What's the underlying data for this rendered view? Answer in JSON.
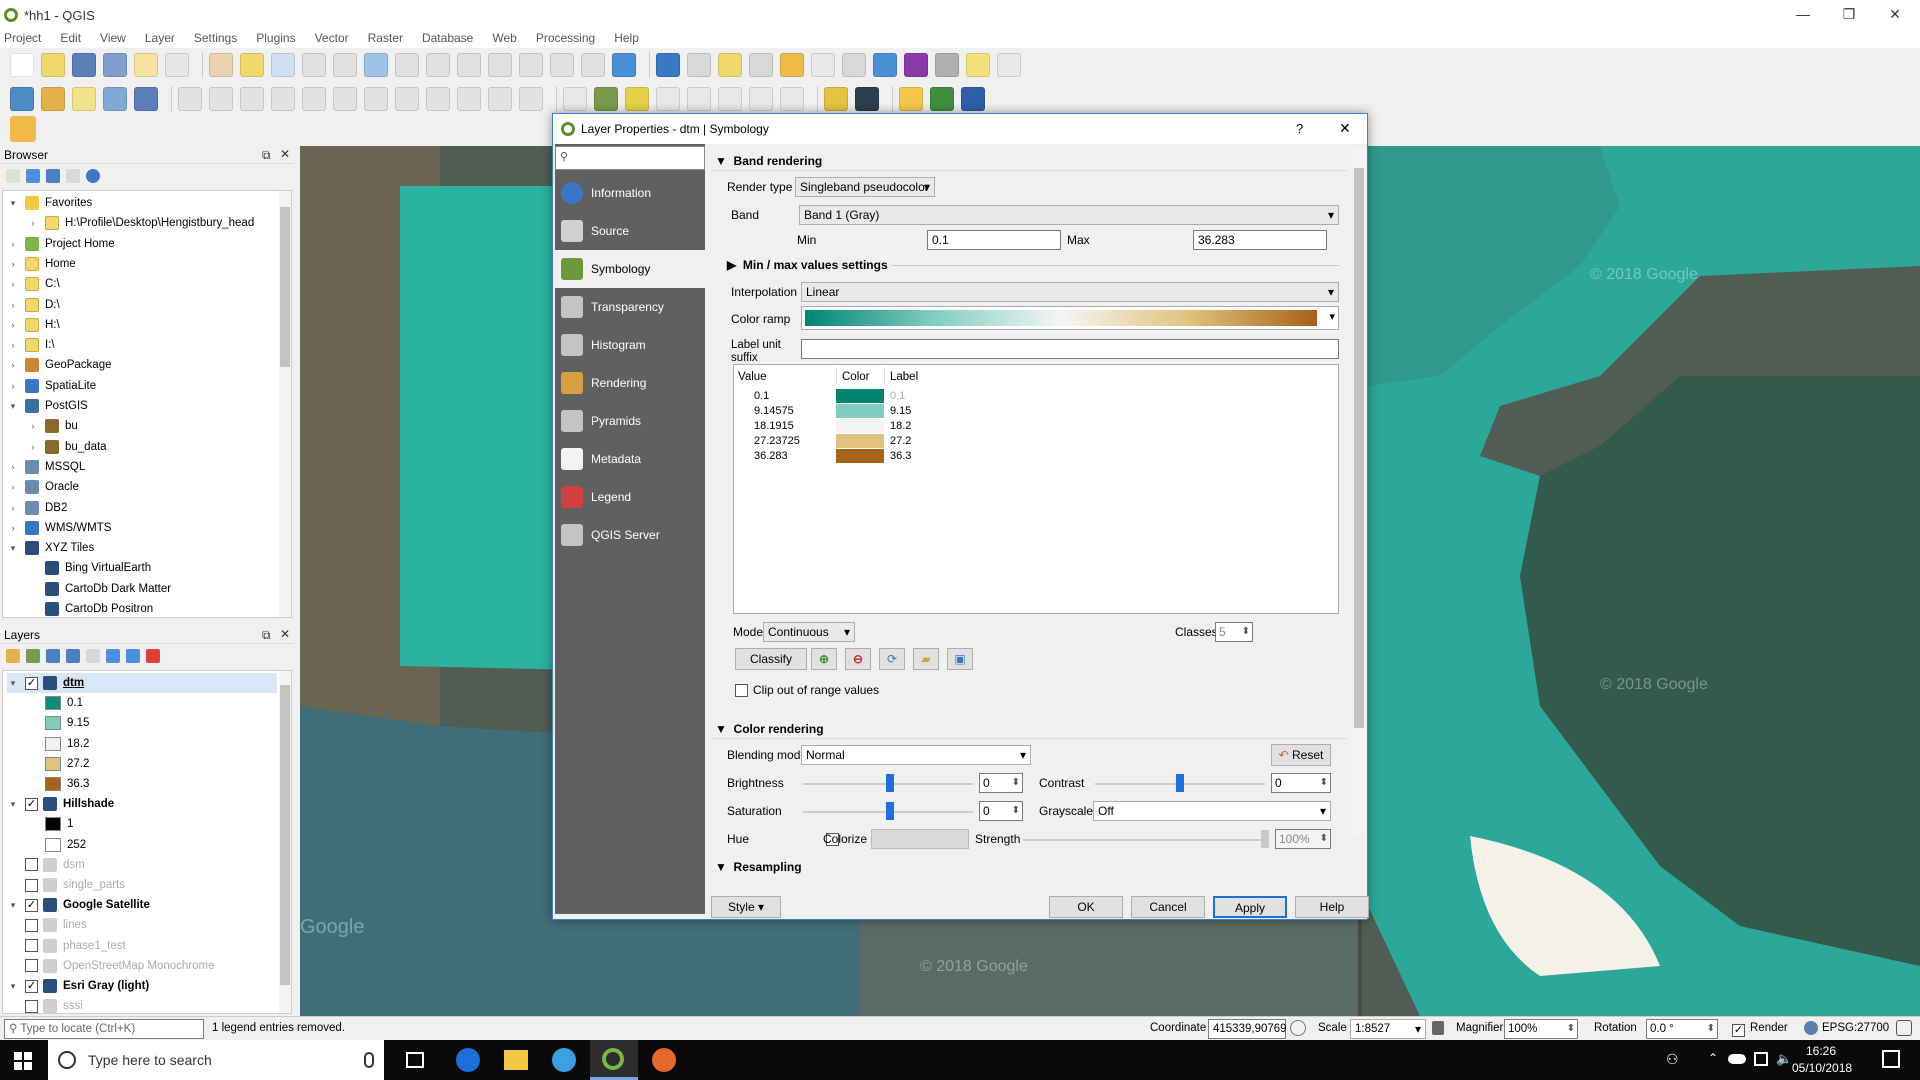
{
  "window": {
    "title": "*hh1 - QGIS",
    "controls": [
      "—",
      "❐",
      "✕"
    ]
  },
  "menu": [
    "Project",
    "Edit",
    "View",
    "Layer",
    "Settings",
    "Plugins",
    "Vector",
    "Raster",
    "Database",
    "Web",
    "Processing",
    "Help"
  ],
  "browser": {
    "title": "Browser",
    "items": [
      {
        "label": "Favorites",
        "type": "star",
        "level": 0,
        "expanded": true
      },
      {
        "label": "H:\\Profile\\Desktop\\Hengistbury_head",
        "type": "folder",
        "level": 1
      },
      {
        "label": "Project Home",
        "type": "home-green",
        "level": 0
      },
      {
        "label": "Home",
        "type": "folder",
        "level": 0
      },
      {
        "label": "C:\\",
        "type": "folder",
        "level": 0
      },
      {
        "label": "D:\\",
        "type": "folder",
        "level": 0
      },
      {
        "label": "H:\\",
        "type": "folder",
        "level": 0
      },
      {
        "label": "I:\\",
        "type": "folder",
        "level": 0
      },
      {
        "label": "GeoPackage",
        "type": "geopackage",
        "level": 0
      },
      {
        "label": "SpatiaLite",
        "type": "feather",
        "level": 0
      },
      {
        "label": "PostGIS",
        "type": "elephant",
        "level": 0,
        "expanded": true
      },
      {
        "label": "bu",
        "type": "schema",
        "level": 1
      },
      {
        "label": "bu_data",
        "type": "schema",
        "level": 1
      },
      {
        "label": "MSSQL",
        "type": "db",
        "level": 0
      },
      {
        "label": "Oracle",
        "type": "db",
        "level": 0
      },
      {
        "label": "DB2",
        "type": "db",
        "level": 0
      },
      {
        "label": "WMS/WMTS",
        "type": "globe",
        "level": 0
      },
      {
        "label": "XYZ Tiles",
        "type": "tiles",
        "level": 0,
        "expanded": true
      },
      {
        "label": "Bing VirtualEarth",
        "type": "tiles",
        "level": 1
      },
      {
        "label": "CartoDb Dark Matter",
        "type": "tiles",
        "level": 1
      },
      {
        "label": "CartoDb Positron",
        "type": "tiles",
        "level": 1
      }
    ]
  },
  "layers": {
    "title": "Layers",
    "items": [
      {
        "label": "dtm",
        "kind": "layer",
        "checked": true,
        "bold": true,
        "underline": true,
        "expanded": true
      },
      {
        "label": "0.1",
        "kind": "legend",
        "color": "#118a7a"
      },
      {
        "label": "9.15",
        "kind": "legend",
        "color": "#7fcdbb"
      },
      {
        "label": "18.2",
        "kind": "legend",
        "color": "#f2f2f0"
      },
      {
        "label": "27.2",
        "kind": "legend",
        "color": "#dfc27d"
      },
      {
        "label": "36.3",
        "kind": "legend",
        "color": "#a6611a"
      },
      {
        "label": "Hillshade",
        "kind": "layer",
        "checked": true,
        "bold": true,
        "expanded": true
      },
      {
        "label": "1",
        "kind": "legend",
        "color": "#000000"
      },
      {
        "label": "252",
        "kind": "legend",
        "color": "#ffffff"
      },
      {
        "label": "dsm",
        "kind": "layer",
        "checked": false,
        "grey": true
      },
      {
        "label": "single_parts",
        "kind": "layer",
        "checked": false,
        "grey": true
      },
      {
        "label": "Google Satellite",
        "kind": "layer",
        "checked": true,
        "bold": true,
        "expanded": true
      },
      {
        "label": "lines",
        "kind": "layer",
        "checked": false,
        "grey": true
      },
      {
        "label": "phase1_test",
        "kind": "layer",
        "checked": false,
        "grey": true
      },
      {
        "label": "OpenStreetMap Monochrome",
        "kind": "layer",
        "checked": false,
        "grey": true
      },
      {
        "label": "Esri Gray (light)",
        "kind": "layer",
        "checked": true,
        "bold": true,
        "expanded": true
      },
      {
        "label": "sssi",
        "kind": "layer",
        "checked": false,
        "grey": true
      }
    ]
  },
  "map": {
    "watermarks": [
      "© 2018 Google",
      "© 2018 Google",
      "© 2018 Google",
      "Google"
    ]
  },
  "dialog": {
    "title": "Layer Properties - dtm | Symbology",
    "help": "?",
    "close": "✕",
    "nav": [
      {
        "label": "Information",
        "icon": "info-icon",
        "color": "#3a78c3"
      },
      {
        "label": "Source",
        "icon": "source-icon",
        "color": "#d0d0d0"
      },
      {
        "label": "Symbology",
        "icon": "symbology-icon",
        "color": "#6a9a3a",
        "selected": true
      },
      {
        "label": "Transparency",
        "icon": "transparency-icon",
        "color": "#c4c4c4"
      },
      {
        "label": "Histogram",
        "icon": "histogram-icon",
        "color": "#c4c4c4"
      },
      {
        "label": "Rendering",
        "icon": "rendering-icon",
        "color": "#d8a040"
      },
      {
        "label": "Pyramids",
        "icon": "pyramids-icon",
        "color": "#c4c4c4"
      },
      {
        "label": "Metadata",
        "icon": "metadata-icon",
        "color": "#f4f4f4"
      },
      {
        "label": "Legend",
        "icon": "legend-icon",
        "color": "#d04040"
      },
      {
        "label": "QGIS Server",
        "icon": "server-icon",
        "color": "#c4c4c4"
      }
    ],
    "band_rendering": {
      "header": "Band rendering",
      "render_type_label": "Render type",
      "render_type": "Singleband pseudocolor",
      "band_label": "Band",
      "band": "Band 1 (Gray)",
      "min_label": "Min",
      "min": "0.1",
      "max_label": "Max",
      "max": "36.283",
      "minmax_settings": "Min / max values settings",
      "interpolation_label": "Interpolation",
      "interpolation": "Linear",
      "color_ramp_label": "Color ramp",
      "label_unit_label": "Label unit suffix",
      "table_headers": [
        "Value",
        "Color",
        "Label"
      ],
      "table_rows": [
        {
          "value": "0.1",
          "color": "#018571",
          "label": "0.1"
        },
        {
          "value": "9.14575",
          "color": "#80cdc1",
          "label": "9.15"
        },
        {
          "value": "18.1915",
          "color": "#f5f5f5",
          "label": "18.2"
        },
        {
          "value": "27.23725",
          "color": "#dfc27d",
          "label": "27.2"
        },
        {
          "value": "36.283",
          "color": "#a6611a",
          "label": "36.3"
        }
      ],
      "mode_label": "Mode",
      "mode": "Continuous",
      "classes_label": "Classes",
      "classes": "5",
      "classify": "Classify",
      "clip_label": "Clip out of range values"
    },
    "color_rendering": {
      "header": "Color rendering",
      "blending_label": "Blending mode",
      "blending": "Normal",
      "reset": "Reset",
      "brightness_label": "Brightness",
      "brightness": "0",
      "contrast_label": "Contrast",
      "contrast": "0",
      "saturation_label": "Saturation",
      "saturation": "0",
      "grayscale_label": "Grayscale",
      "grayscale": "Off",
      "hue_label": "Hue",
      "colorize_label": "Colorize",
      "strength_label": "Strength",
      "strength": "100%"
    },
    "resampling_header": "Resampling",
    "buttons": {
      "style": "Style",
      "ok": "OK",
      "cancel": "Cancel",
      "apply": "Apply",
      "help": "Help"
    }
  },
  "statusbar": {
    "locate_placeholder": "Type to locate (Ctrl+K)",
    "message": "1 legend entries removed.",
    "coordinate_label": "Coordinate",
    "coordinate": "415339,90769",
    "scale_label": "Scale",
    "scale": "1:8527",
    "magnifier_label": "Magnifier",
    "magnifier": "100%",
    "rotation_label": "Rotation",
    "rotation": "0.0 °",
    "render_label": "Render",
    "crs": "EPSG:27700"
  },
  "taskbar": {
    "search_placeholder": "Type here to search",
    "time": "16:26",
    "date": "05/10/2018"
  }
}
